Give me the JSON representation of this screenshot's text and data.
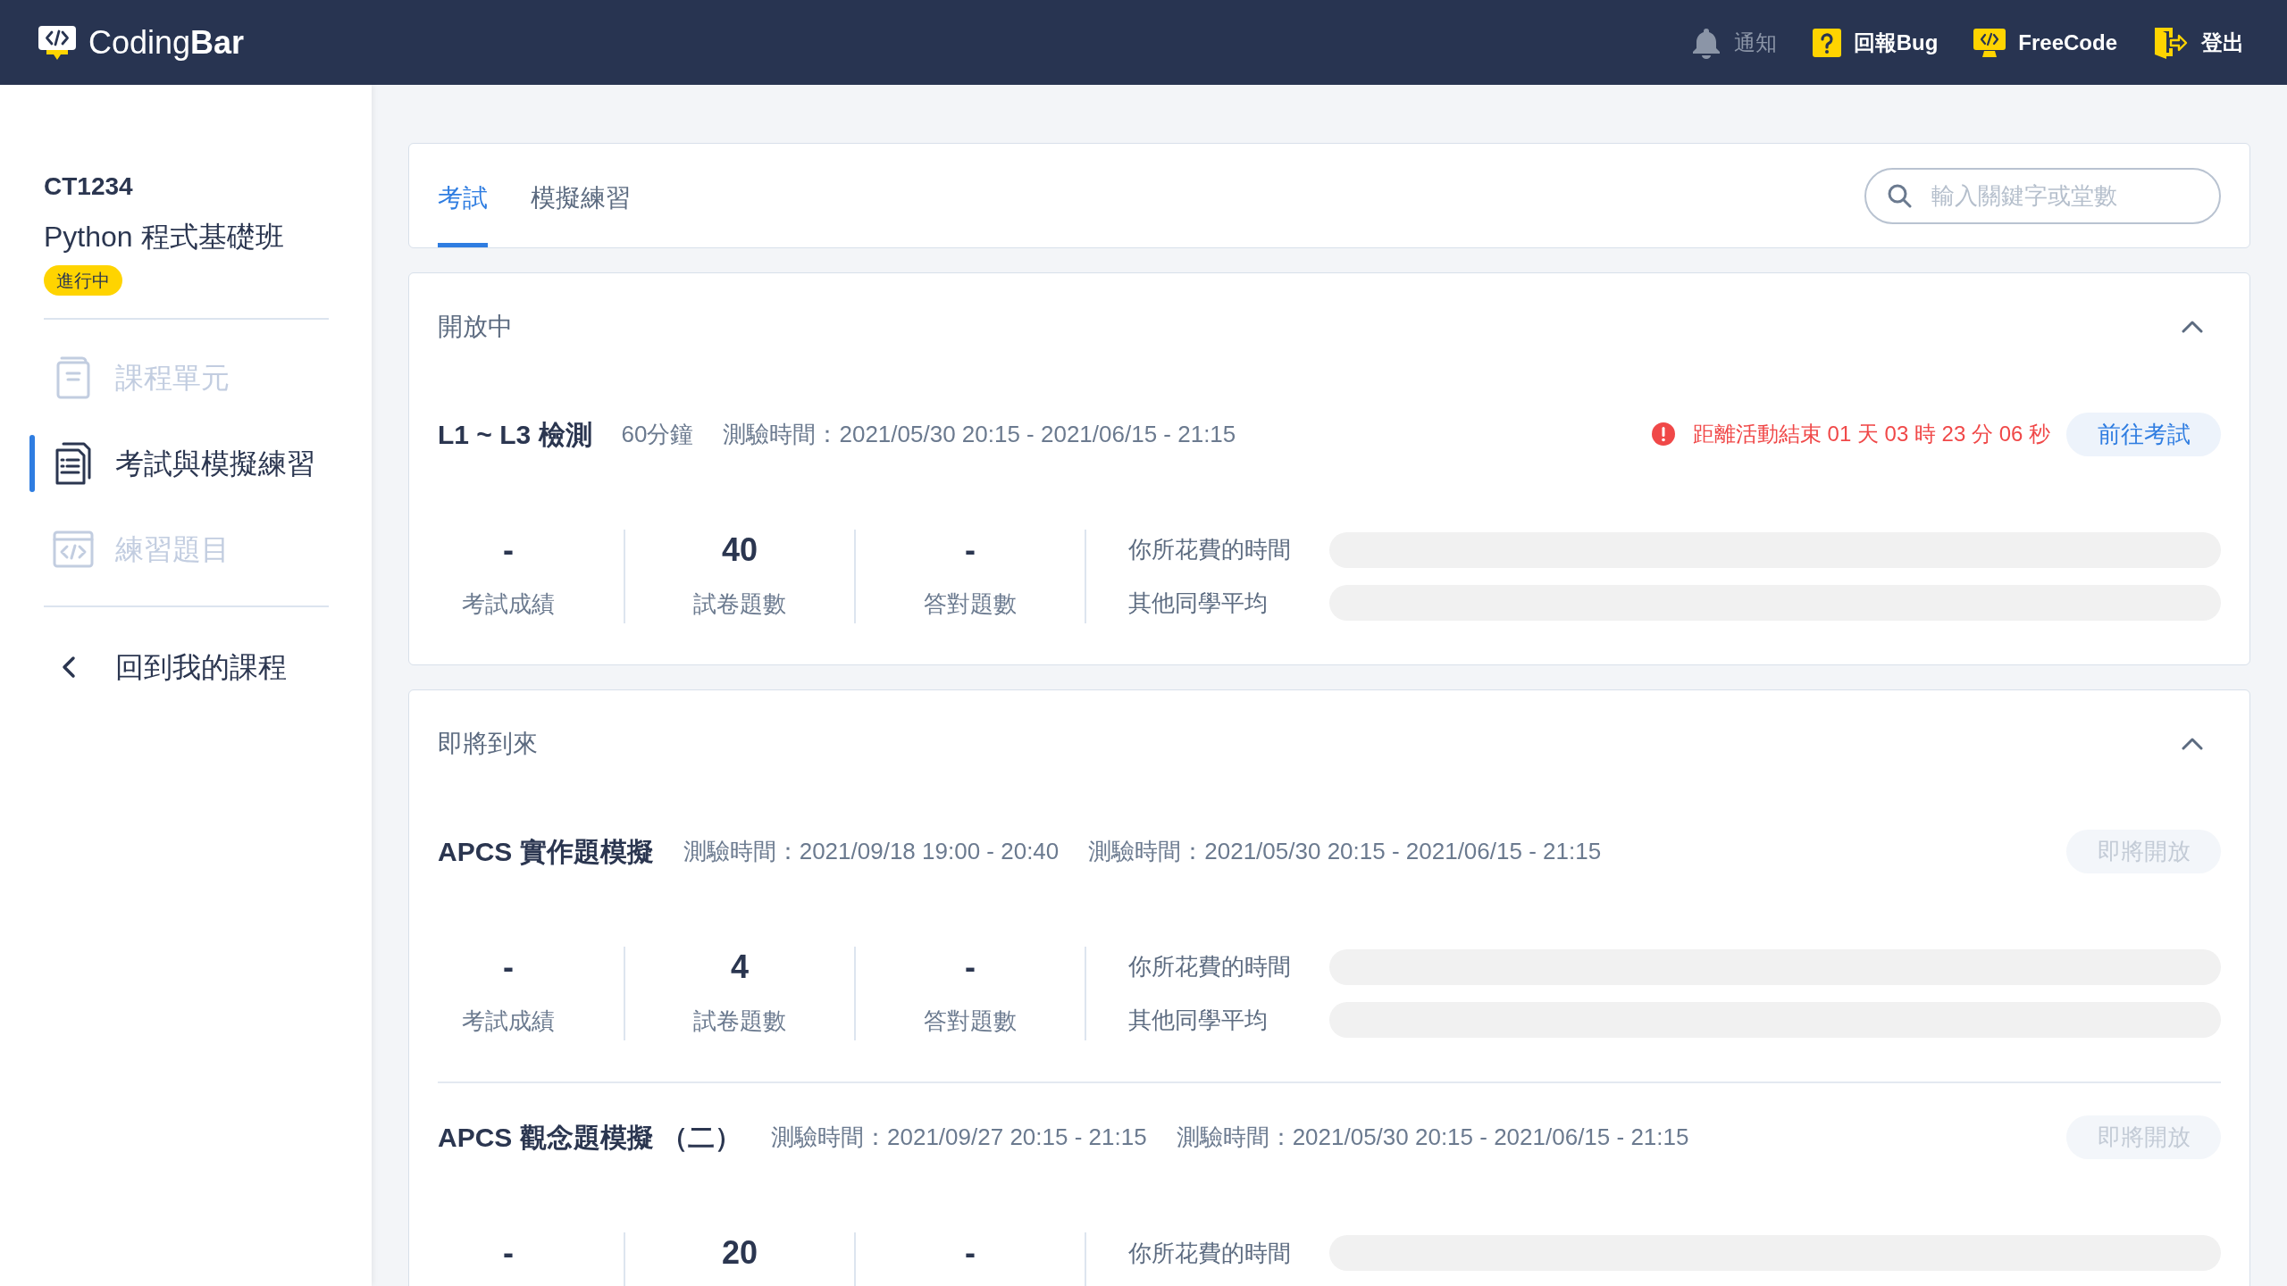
{
  "header": {
    "logo": "Coding**Bar**",
    "actions": [
      {
        "label": "通知",
        "disabled": true
      },
      {
        "label": "回報Bug",
        "disabled": false
      },
      {
        "label": "FreeCode",
        "disabled": false
      },
      {
        "label": "登出",
        "disabled": false
      }
    ]
  },
  "sidebar": {
    "course_code": "CT1234",
    "course_name": "Python 程式基礎班",
    "status_badge": "進行中",
    "items": [
      {
        "label": "課程單元",
        "selected": false
      },
      {
        "label": "考試與模擬練習",
        "selected": true
      },
      {
        "label": "練習題目",
        "selected": false
      }
    ],
    "back_link": "回到我的課程"
  },
  "tabs": [
    {
      "label": "考試",
      "selected": true
    },
    {
      "label": "模擬練習",
      "selected": false
    }
  ],
  "search": {
    "placeholder": "輸入關鍵字或堂數"
  },
  "sections": [
    {
      "title": "開放中",
      "expanded": true,
      "exams": [
        {
          "title": "L1 ~ L3 檢測",
          "meta": [
            "60分鐘",
            "測驗時間：2021/05/30 20:15 - 2021/06/15 - 21:15"
          ],
          "countdown": "距離活動結束 01 天 03 時 23 分 06 秒",
          "button": {
            "label": "前往考試",
            "disabled": false
          },
          "stats": [
            {
              "value": "-",
              "label": "考試成績"
            },
            {
              "value": "40",
              "label": "試卷題數"
            },
            {
              "value": "-",
              "label": "答對題數"
            }
          ],
          "bars": [
            {
              "label": "你所花費的時間"
            },
            {
              "label": "其他同學平均"
            }
          ]
        }
      ]
    },
    {
      "title": "即將到來",
      "expanded": true,
      "exams": [
        {
          "title": "APCS 實作題模擬",
          "meta": [
            "測驗時間：2021/09/18 19:00 - 20:40",
            "測驗時間：2021/05/30 20:15 - 2021/06/15 - 21:15"
          ],
          "button": {
            "label": "即將開放",
            "disabled": true
          },
          "stats": [
            {
              "value": "-",
              "label": "考試成績"
            },
            {
              "value": "4",
              "label": "試卷題數"
            },
            {
              "value": "-",
              "label": "答對題數"
            }
          ],
          "bars": [
            {
              "label": "你所花費的時間"
            },
            {
              "label": "其他同學平均"
            }
          ]
        },
        {
          "title": "APCS 觀念題模擬 （二）",
          "meta": [
            "測驗時間：2021/09/27 20:15 - 21:15",
            "測驗時間：2021/05/30 20:15 - 2021/06/15 - 21:15"
          ],
          "button": {
            "label": "即將開放",
            "disabled": true
          },
          "stats": [
            {
              "value": "-"
            },
            {
              "value": "20"
            },
            {
              "value": "-"
            }
          ],
          "bars": [
            {
              "label": "你所花費的時間"
            }
          ]
        }
      ]
    }
  ]
}
